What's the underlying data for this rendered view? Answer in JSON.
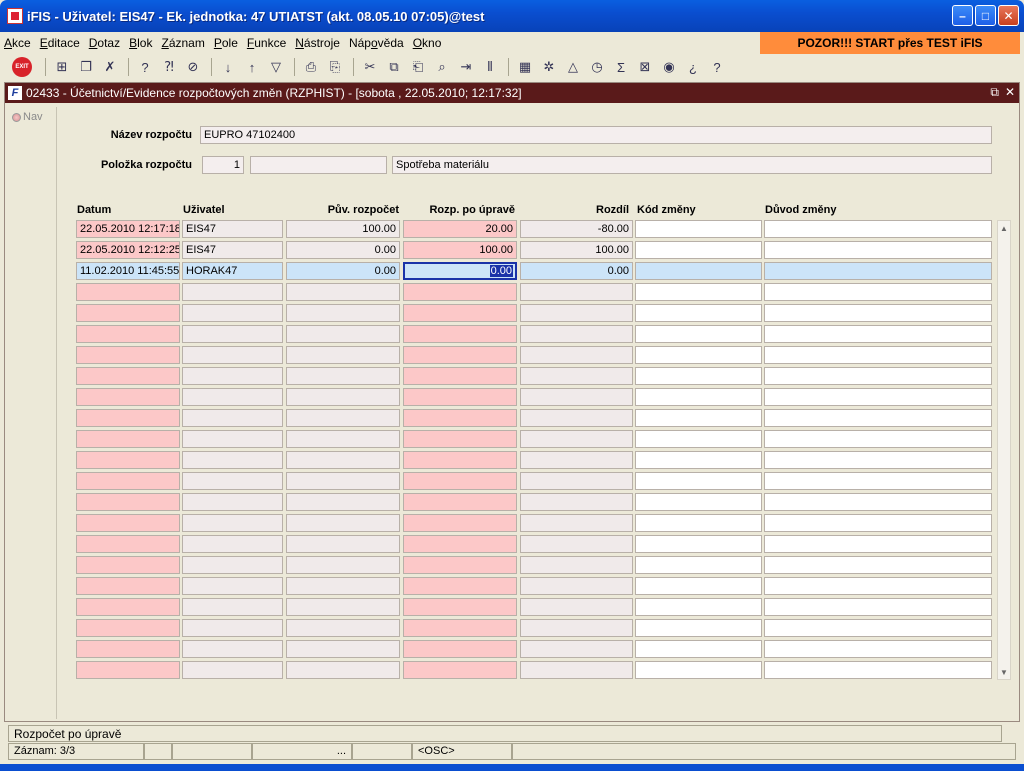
{
  "window": {
    "title": "iFIS - Uživatel: EIS47 - Ek. jednotka: 47 UTIATST (akt. 08.05.10 07:05)@test",
    "minimize_icon": "minimize-icon",
    "maximize_icon": "maximize-icon",
    "close_icon": "close-icon"
  },
  "menu": {
    "items": [
      {
        "u": "A",
        "rest": "kce"
      },
      {
        "u": "E",
        "rest": "ditace"
      },
      {
        "u": "D",
        "rest": "otaz"
      },
      {
        "u": "B",
        "rest": "lok"
      },
      {
        "u": "Z",
        "rest": "áznam"
      },
      {
        "u": "P",
        "rest": "ole"
      },
      {
        "u": "F",
        "rest": "unkce"
      },
      {
        "u": "N",
        "rest": "ástroje"
      },
      {
        "pre": "Náp",
        "u": "o",
        "rest": "věda"
      },
      {
        "u": "O",
        "rest": "kno"
      }
    ],
    "warning": "POZOR!!!  START přes TEST iFIS"
  },
  "toolbar": {
    "exit_label": "EXIT"
  },
  "form": {
    "title": "02433 - Účetnictví/Evidence rozpočtových změn (RZPHIST) - [sobota , 22.05.2010; 12:17:32]",
    "nav_label": "Nav",
    "nazev_label": "Název rozpočtu",
    "nazev_value": "EUPRO 47102400",
    "polozka_label": "Položka rozpočtu",
    "polozka_num": "1",
    "polozka_code": "",
    "polozka_text": "Spotřeba materiálu"
  },
  "grid": {
    "headers": {
      "datum": "Datum",
      "uzivatel": "Uživatel",
      "puv": "Pův. rozpočet",
      "rozp": "Rozp. po úpravě",
      "rozdil": "Rozdíl",
      "kod": "Kód změny",
      "duvod": "Důvod změny"
    },
    "rows": [
      {
        "datum": "22.05.2010 12:17:18",
        "uzivatel": "EIS47",
        "puv": "100.00",
        "rozp": "20.00",
        "rozdil": "-80.00",
        "kod": "",
        "duvod": ""
      },
      {
        "datum": "22.05.2010 12:12:25",
        "uzivatel": "EIS47",
        "puv": "0.00",
        "rozp": "100.00",
        "rozdil": "100.00",
        "kod": "",
        "duvod": ""
      },
      {
        "datum": "11.02.2010 11:45:55",
        "uzivatel": "HORAK47",
        "puv": "0.00",
        "rozp": "0.00",
        "rozdil": "0.00",
        "kod": "",
        "duvod": ""
      }
    ],
    "active_row": 2,
    "empty_rows": 19
  },
  "status": {
    "hint": "Rozpočet po úpravě",
    "record": "Záznam: 3/3",
    "seg2": "",
    "seg3": "",
    "seg4": "...",
    "seg5": "",
    "seg6": "",
    "mode": "<OSC>"
  }
}
